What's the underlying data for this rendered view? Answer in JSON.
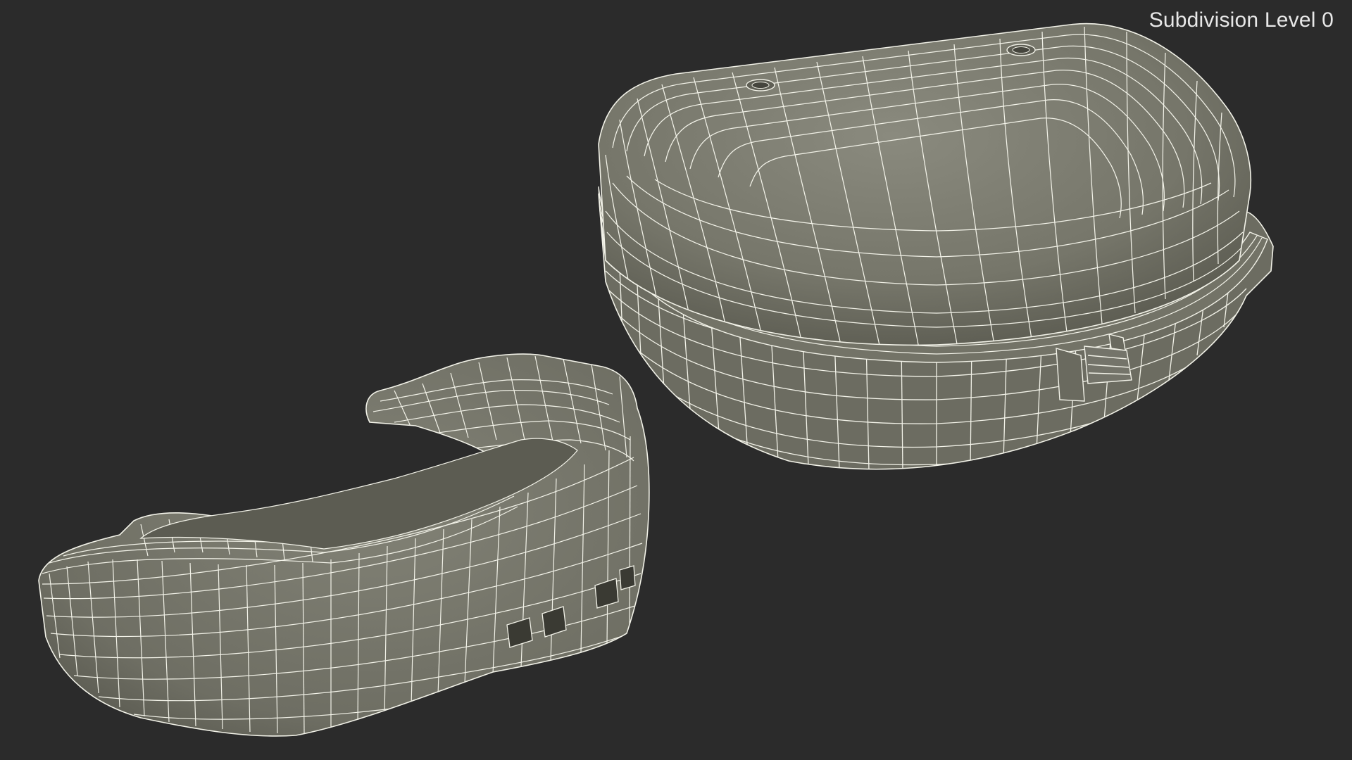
{
  "viewport": {
    "label": "Subdivision Level 0",
    "background_color": "#2b2b2b",
    "mesh_fill_color": "#7a7a6e",
    "mesh_shadow_color": "#5a5a50",
    "wireframe_color": "#f2f2e8"
  },
  "objects": [
    {
      "name": "mouth-guard",
      "kind": "wireframe-mesh"
    },
    {
      "name": "mouth-guard-case",
      "kind": "wireframe-mesh"
    }
  ]
}
